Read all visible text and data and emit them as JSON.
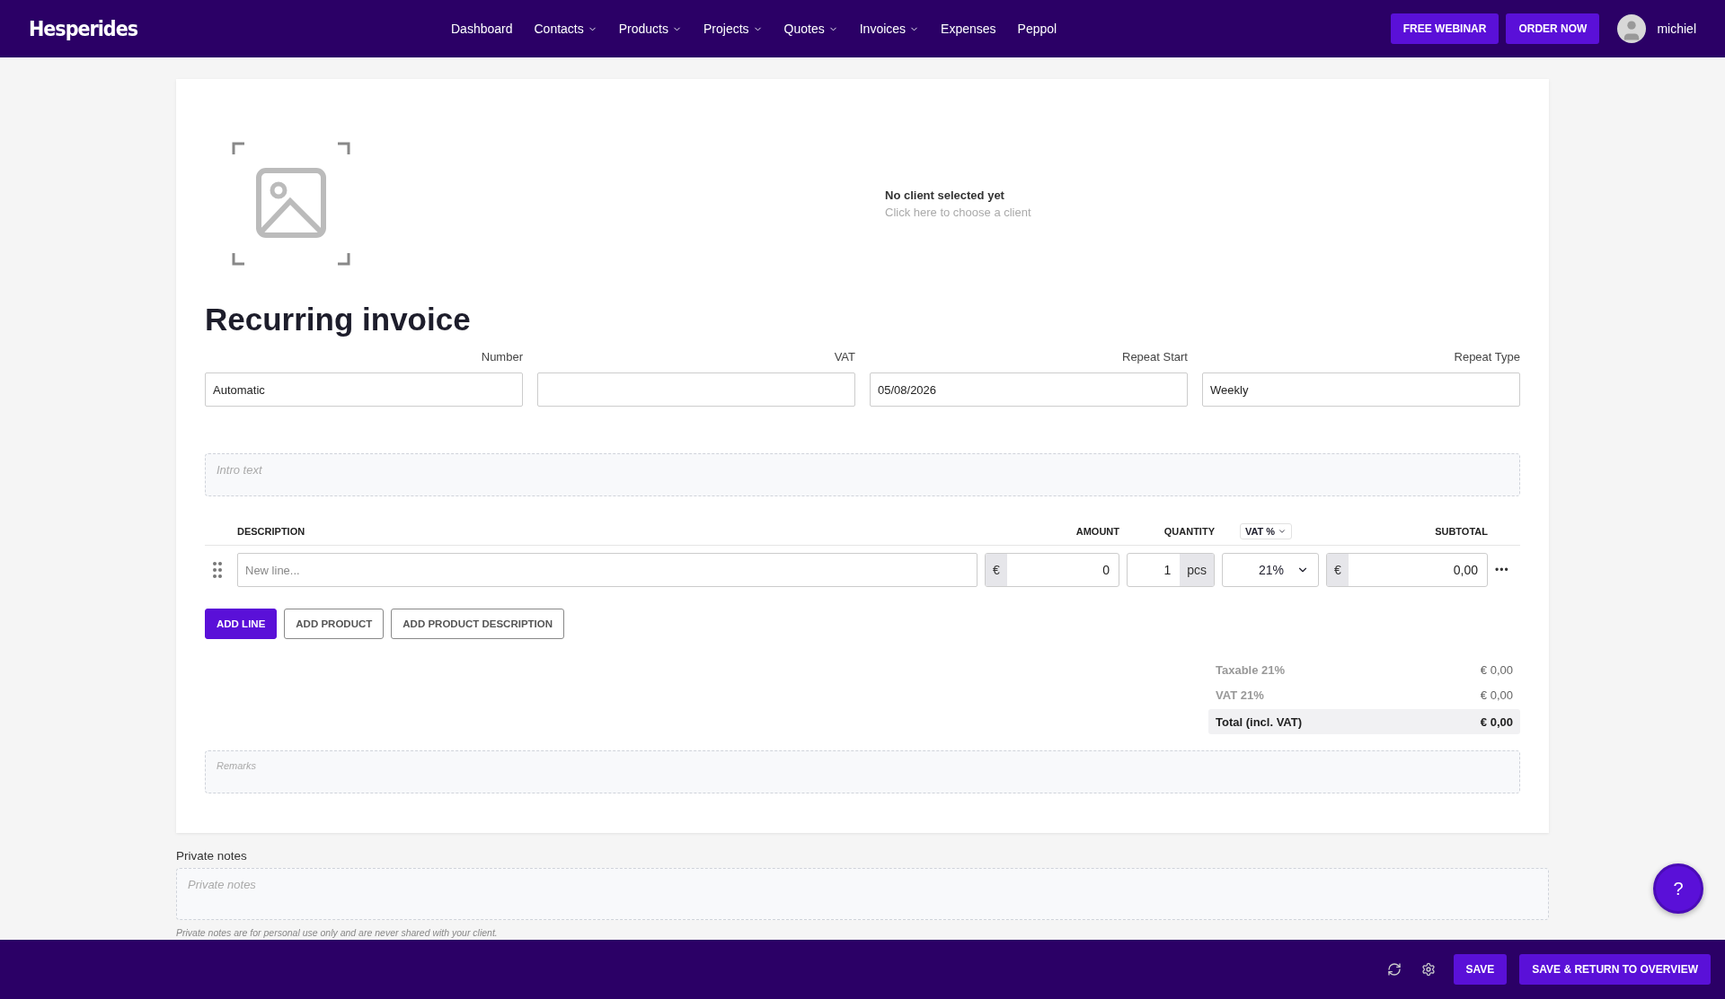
{
  "nav": {
    "logo": "Hesperides",
    "items": [
      {
        "label": "Dashboard",
        "dropdown": false
      },
      {
        "label": "Contacts",
        "dropdown": true
      },
      {
        "label": "Products",
        "dropdown": true
      },
      {
        "label": "Projects",
        "dropdown": true
      },
      {
        "label": "Quotes",
        "dropdown": true
      },
      {
        "label": "Invoices",
        "dropdown": true
      },
      {
        "label": "Expenses",
        "dropdown": false
      },
      {
        "label": "Peppol",
        "dropdown": false
      }
    ],
    "buttons": [
      "FREE WEBINAR",
      "ORDER NOW"
    ],
    "user": "michiel"
  },
  "client": {
    "title": "No client selected yet",
    "hint": "Click here to choose a client"
  },
  "title": "Recurring invoice",
  "fields": [
    {
      "label": "Number",
      "value": "Automatic"
    },
    {
      "label": "VAT"
    },
    {
      "label": "Repeat Start",
      "value": "05/08/2026"
    },
    {
      "label": "Repeat Type",
      "value": "Weekly"
    }
  ],
  "intro": {
    "placeholder": "Intro text"
  },
  "table": {
    "columns": [
      {
        "label": "DESCRIPTION",
        "dropdown": false
      },
      {
        "label": "AMOUNT",
        "dropdown": false
      },
      {
        "label": "QUANTITY",
        "dropdown": false
      },
      {
        "label": "VAT %",
        "dropdown": true
      },
      {
        "label": "SUBTOTAL",
        "dropdown": false
      }
    ],
    "line": {
      "placeholder": "New line...",
      "amount_currency": "€",
      "amount": "0",
      "quantity": "1",
      "unit": "pcs",
      "vat": "21%",
      "subtotal_currency": "€",
      "subtotal": "0,00",
      "menu": "•••"
    }
  },
  "actions": [
    {
      "label": "ADD LINE",
      "primary": true
    },
    {
      "label": "ADD PRODUCT",
      "primary": false
    },
    {
      "label": "ADD PRODUCT DESCRIPTION",
      "primary": false
    }
  ],
  "totals": [
    {
      "label": "Taxable 21%",
      "value": "€ 0,00",
      "total": false
    },
    {
      "label": "VAT 21%",
      "value": "€ 0,00",
      "total": false
    },
    {
      "label": "Total (incl. VAT)",
      "value": "€ 0,00",
      "total": true
    }
  ],
  "remarks": {
    "placeholder": "Remarks"
  },
  "private_notes": {
    "label": "Private notes",
    "placeholder": "Private notes",
    "hint": "Private notes are for personal use only and are never shared with your client."
  },
  "help": "?",
  "footer": {
    "buttons": [
      "SAVE",
      "SAVE & RETURN TO OVERVIEW"
    ]
  }
}
